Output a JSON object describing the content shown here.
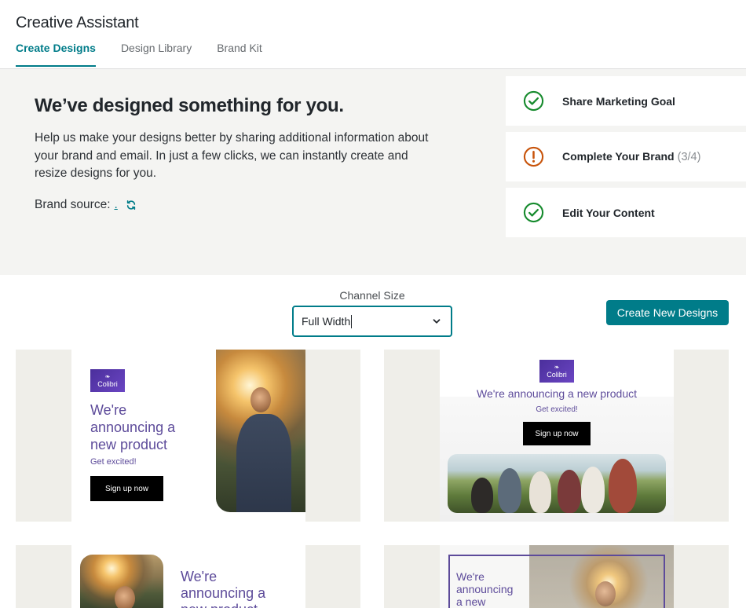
{
  "app": {
    "title": "Creative Assistant"
  },
  "tabs": [
    {
      "label": "Create Designs",
      "active": true
    },
    {
      "label": "Design Library",
      "active": false
    },
    {
      "label": "Brand Kit",
      "active": false
    }
  ],
  "hero": {
    "title": "We’ve designed something for you.",
    "description": "Help us make your designs better by sharing additional information about your brand and email. In just a few clicks, we can instantly create and resize designs for you.",
    "brand_source_label": "Brand source:",
    "brand_source_link": "."
  },
  "steps": [
    {
      "label": "Share Marketing Goal",
      "status": "complete",
      "count": ""
    },
    {
      "label": "Complete Your Brand",
      "status": "warning",
      "count": "(3/4)"
    },
    {
      "label": "Edit Your Content",
      "status": "complete",
      "count": ""
    }
  ],
  "controls": {
    "channel_size_label": "Channel Size",
    "channel_size_value": "Full Width",
    "create_button": "Create New Designs"
  },
  "designs": {
    "logo_text": "Colibri",
    "headline": "We're announcing a new product",
    "headline_wrapped_1": "We're",
    "headline_wrapped_2": "announcing a",
    "headline_wrapped_3": "new product",
    "sub": "Get excited!",
    "cta": "Sign up now",
    "card4_line1": "We're",
    "card4_line2": "announcing",
    "card4_line3": "a new"
  },
  "colors": {
    "accent": "#007c89",
    "success": "#178b2e",
    "warning": "#c8540b",
    "brand_purple": "#5d4b9a"
  }
}
